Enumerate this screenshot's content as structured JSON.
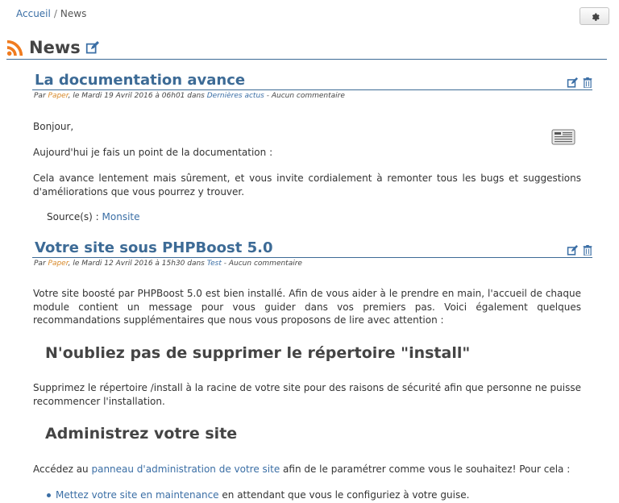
{
  "breadcrumb": {
    "home": "Accueil",
    "sep": "/",
    "current": "News"
  },
  "page": {
    "title": "News"
  },
  "articles": [
    {
      "title": "La documentation avance",
      "meta": {
        "by": "Par",
        "author": "Paper",
        "date": ", le Mardi 19 Avril 2016 à 06h01 dans",
        "category": "Dernières actus",
        "comments": "- Aucun commentaire"
      },
      "paragraphs": [
        "Bonjour,",
        "Aujourd'hui je fais un point de la documentation :",
        "Cela avance lentement mais sûrement, et vous invite cordialement à remonter tous les bugs et suggestions d'améliorations que vous pourrez y trouver."
      ],
      "source_label": "Source(s) :",
      "source_link": "Monsite"
    },
    {
      "title": "Votre site sous PHPBoost 5.0",
      "meta": {
        "by": "Par",
        "author": "Paper",
        "date": ", le Mardi 12 Avril 2016 à 15h30 dans",
        "category": "Test",
        "comments": "- Aucun commentaire"
      },
      "intro": "Votre site boosté par PHPBoost 5.0 est bien installé. Afin de vous aider à le prendre en main, l'accueil de chaque module contient un message pour vous guider dans vos premiers pas. Voici également quelques recommandations supplémentaires que nous vous proposons de lire avec attention :",
      "h1": "N'oubliez pas de supprimer le répertoire \"install\"",
      "h1_text": "Supprimez le répertoire /install à la racine de votre site pour des raisons de sécurité afin que personne ne puisse recommencer l'installation.",
      "h2": "Administrez votre site",
      "h2_before": "Accédez au ",
      "h2_link": "panneau d'administration de votre site",
      "h2_after": " afin de le paramétrer comme vous le souhaitez! Pour cela :",
      "bullet_link": "Mettez votre site en maintenance",
      "bullet_after": " en attendant que vous le configuriez à votre guise."
    }
  ]
}
